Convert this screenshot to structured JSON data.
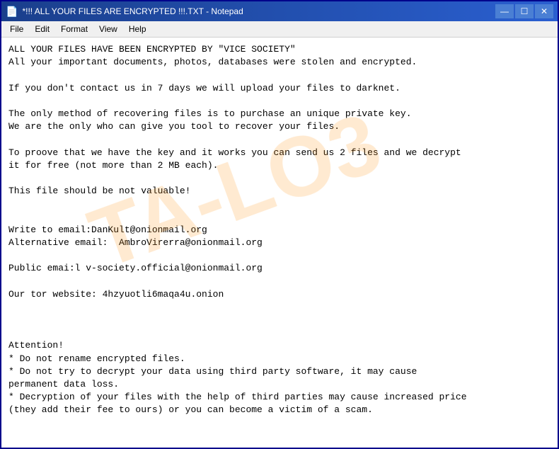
{
  "window": {
    "title": "*!!! ALL YOUR FILES ARE ENCRYPTED !!!.TXT - Notepad",
    "icon": "📄"
  },
  "title_buttons": {
    "minimize": "—",
    "maximize": "☐",
    "close": "✕"
  },
  "menu": {
    "items": [
      "File",
      "Edit",
      "Format",
      "View",
      "Help"
    ]
  },
  "content": "ALL YOUR FILES HAVE BEEN ENCRYPTED BY \"VICE SOCIETY\"\nAll your important documents, photos, databases were stolen and encrypted.\n\nIf you don't contact us in 7 days we will upload your files to darknet.\n\nThe only method of recovering files is to purchase an unique private key.\nWe are the only who can give you tool to recover your files.\n\nTo proove that we have the key and it works you can send us 2 files and we decrypt\nit for free (not more than 2 MB each).\n\nThis file should be not valuable!\n\n\nWrite to email:DanKult@onionmail.org\nAlternative email:  AmbroVirerra@onionmail.org\n\nPublic emai:l v-society.official@onionmail.org\n\nOur tor website: 4hzyuotli6maqa4u.onion\n\n\n\nAttention!\n* Do not rename encrypted files.\n* Do not try to decrypt your data using third party software, it may cause\npermanent data loss.\n* Decryption of your files with the help of third parties may cause increased price\n(they add their fee to ours) or you can become a victim of a scam.",
  "watermark_text": "TA-LO3"
}
